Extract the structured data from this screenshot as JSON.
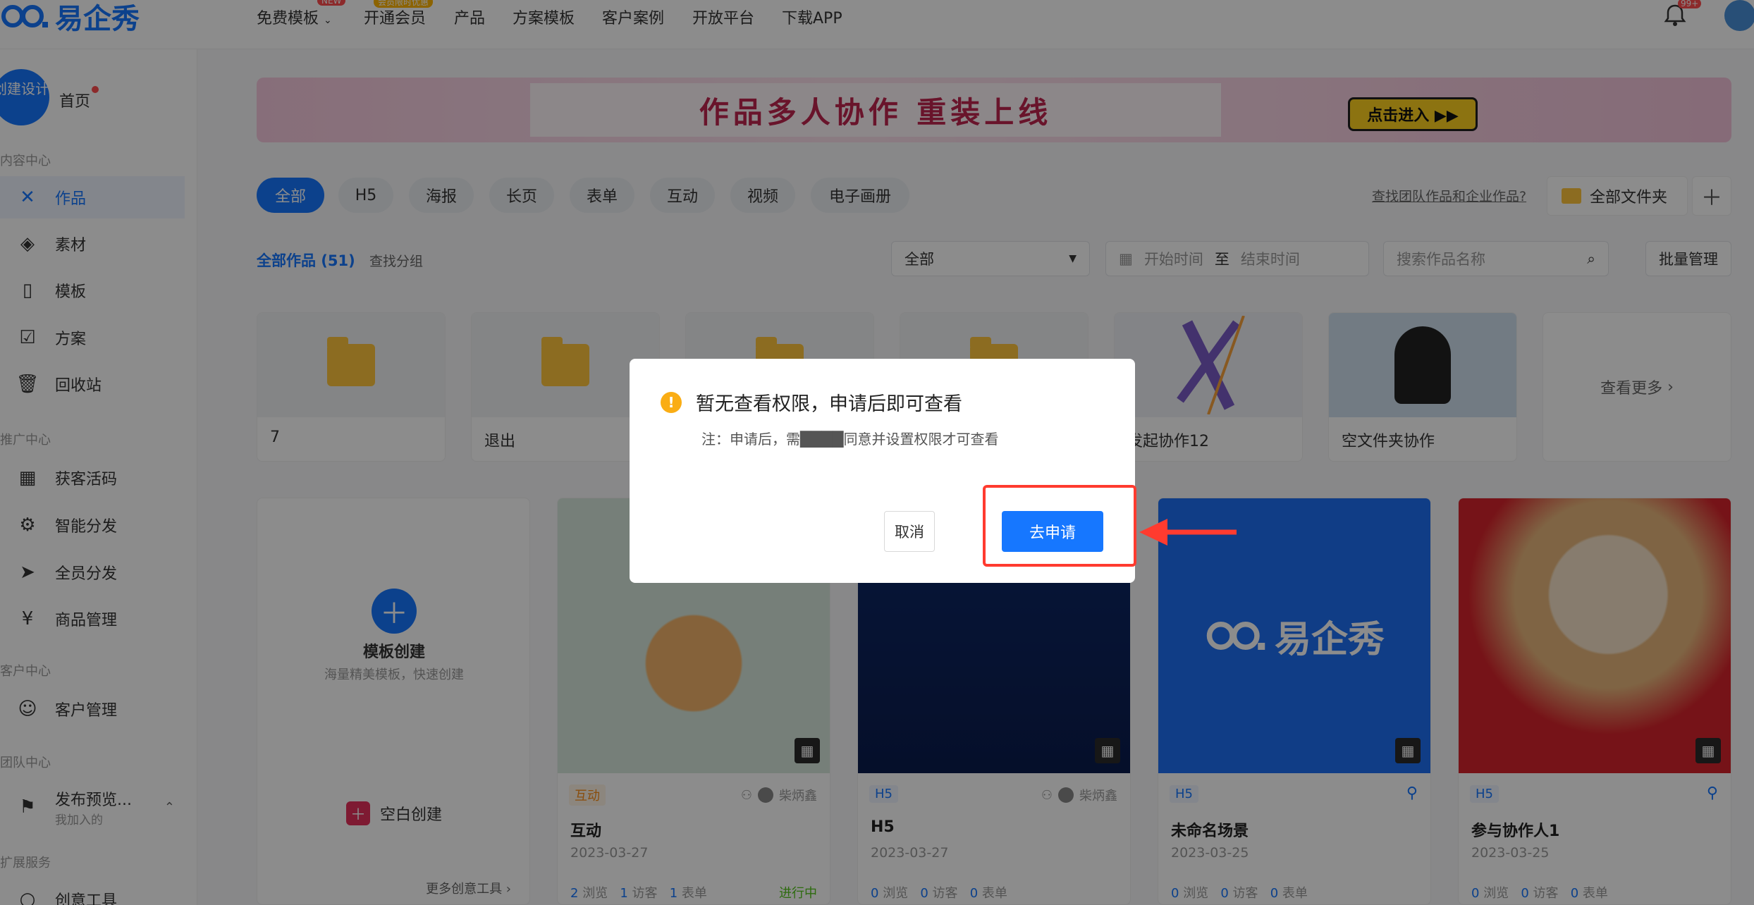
{
  "nav": {
    "logo_text": "易企秀",
    "items": [
      "免费模板",
      "开通会员",
      "产品",
      "方案模板",
      "客户案例",
      "开放平台",
      "下载APP"
    ],
    "badge_new": "NEW",
    "badge_vip": "会员限时优惠",
    "notification_count": "99+"
  },
  "sidebar": {
    "create_label": "创建设计",
    "home": "首页",
    "sections": {
      "content": "内容中心",
      "promo": "推广中心",
      "customer": "客户中心",
      "team": "团队中心",
      "ext": "扩展服务"
    },
    "items": {
      "works": "作品",
      "materials": "素材",
      "templates": "模板",
      "plans": "方案",
      "recycle": "回收站",
      "leads": "获客活码",
      "smart": "智能分发",
      "all": "全员分发",
      "goods": "商品管理",
      "crm": "客户管理",
      "publish": "发布预览...",
      "publish_sub": "我加入的",
      "tools": "创意工具"
    }
  },
  "banner": {
    "title": "作品多人协作  重装上线",
    "button": "点击进入 ▶▶"
  },
  "filters": [
    "全部",
    "H5",
    "海报",
    "长页",
    "表单",
    "互动",
    "视频",
    "电子画册"
  ],
  "toolbar": {
    "team_link": "查找团队作品和企业作品?",
    "folder_all": "全部文件夹",
    "works_count": "全部作品 (51)",
    "find_group": "查找分组",
    "select_value": "全部",
    "start_placeholder": "开始时间",
    "to": "至",
    "end_placeholder": "结束时间",
    "search_placeholder": "搜索作品名称",
    "batch": "批量管理"
  },
  "folders": [
    {
      "name": "7"
    },
    {
      "name": "退出"
    },
    {
      "name": ""
    },
    {
      "name": ""
    },
    {
      "name": "发起协作12"
    },
    {
      "name": "空文件夹协作"
    }
  ],
  "see_more": "查看更多",
  "create_card": {
    "template": "模板创建",
    "template_sub": "海量精美模板，快速创建",
    "blank": "空白创建",
    "more_tools": "更多创意工具"
  },
  "works": [
    {
      "tag": "互动",
      "owner": "柴炳鑫",
      "title": "互动",
      "date": "2023-03-27",
      "views": "2",
      "visitors": "1",
      "forms": "1",
      "status": "进行中"
    },
    {
      "tag": "H5",
      "owner": "柴炳鑫",
      "title": "H5",
      "date": "2023-03-27",
      "views": "0",
      "visitors": "0",
      "forms": "0"
    },
    {
      "tag": "H5",
      "title": "未命名场景",
      "date": "2023-03-25",
      "views": "0",
      "visitors": "0",
      "forms": "0",
      "logo": "易企秀"
    },
    {
      "tag": "H5",
      "title": "参与协作人1",
      "date": "2023-03-25",
      "views": "0",
      "visitors": "0",
      "forms": "0"
    }
  ],
  "stat_labels": {
    "views": "浏览",
    "visitors": "访客",
    "forms": "表单"
  },
  "dialog": {
    "title": "暂无查看权限，申请后即可查看",
    "note": "注：申请后，需████同意并设置权限才可查看",
    "cancel": "取消",
    "apply": "去申请"
  },
  "colors": {
    "primary": "#1677ff",
    "warning": "#faad14",
    "annotation": "#ff3b2f"
  }
}
